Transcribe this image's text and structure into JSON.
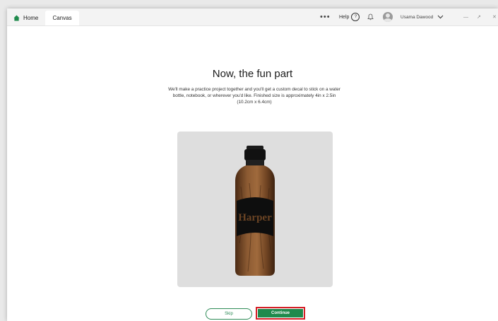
{
  "tabs": {
    "home_label": "Home",
    "canvas_label": "Canvas"
  },
  "topbar": {
    "more_label": "•••",
    "help_label": "Help",
    "help_symbol": "?",
    "user_name": "Usama Dawood",
    "minimize": "—",
    "maximize": "↗",
    "close": "✕"
  },
  "main": {
    "title": "Now, the fun part",
    "description": "We'll make a practice project together and you'll get a custom decal to stick on a water bottle, notebook, or wherever you'd like. Finished size is approximately 4in x 2.5in (10.2cm x 6.4cm)",
    "decal_text": "Harper"
  },
  "actions": {
    "skip_label": "Skip",
    "continue_label": "Continue"
  },
  "colors": {
    "brand_green": "#1f8a4c",
    "highlight_red": "#d61f26"
  }
}
